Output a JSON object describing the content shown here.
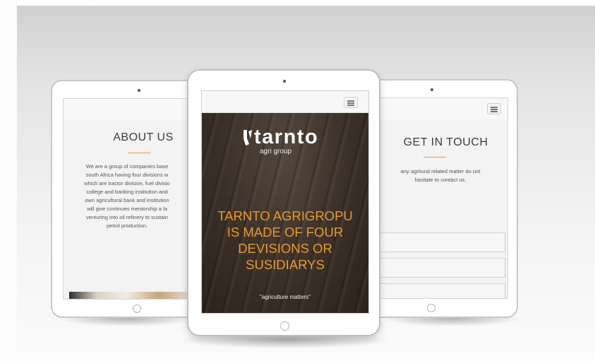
{
  "left_tablet": {
    "heading": "ABOUT US",
    "lines": [
      "We are a group of companies base",
      "south Africa having four divisions w",
      "which are tractor division, fuel divisio",
      "college and banking institution and",
      "own agricultural bank and institution",
      "will give continues mentorship a la",
      "venturing into oil refinery to sustain",
      "petrol production."
    ]
  },
  "center_tablet": {
    "logo": "tarnto",
    "logo_sub": "agri group",
    "headline_lines": [
      "TARNTO AGRIGROPU",
      "IS MADE OF FOUR",
      "DEVISIONS OR",
      "SUSIDIARYS"
    ],
    "tagline": "\"agriculture matters\""
  },
  "right_tablet": {
    "heading": "GET IN TOUCH",
    "lines": [
      "any agritural related matter do not",
      "hasitate to contact us."
    ]
  },
  "colors": {
    "accent": "#f0a020",
    "headline": "#e89a2a",
    "soil": "#3b3028"
  },
  "icons": [
    "menu-icon",
    "logo-icon",
    "camera-icon",
    "home-button-icon"
  ]
}
